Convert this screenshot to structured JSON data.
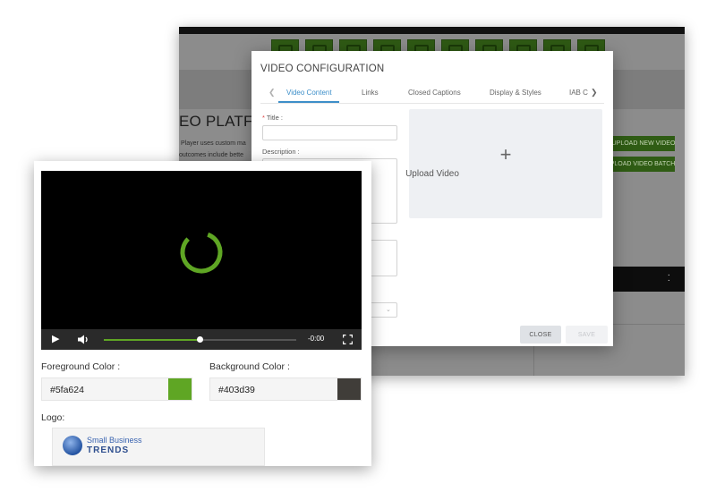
{
  "back_page": {
    "heading": "EO PLATFORM",
    "desc_line1": "Player uses custom ma",
    "desc_line2": "outcomes include bette",
    "upload_new_video": "UPLOAD NEW VIDEO",
    "upload_video_batch": "UPLOAD VIDEO BATCH",
    "toolbar_icons": [
      "home-icon",
      "upload-icon",
      "chart-icon",
      "video-icon",
      "globe-icon",
      "cube-icon",
      "stats-icon",
      "document-icon",
      "save-icon",
      "settings-icon"
    ]
  },
  "modal": {
    "title": "VIDEO CONFIGURATION",
    "tabs": [
      "Video Content",
      "Links",
      "Closed Captions",
      "Display & Styles",
      "IAB C"
    ],
    "active_tab": "Video Content",
    "title_label": "Title :",
    "title_required": "*",
    "description_label": "Description :",
    "upload_plus": "+",
    "upload_label": "Upload Video",
    "close_label": "CLOSE",
    "save_label": "SAVE"
  },
  "player": {
    "time": "-0:00",
    "progress_fraction": 0.5,
    "foreground_label": "Foreground Color :",
    "foreground_value": "#5fa624",
    "background_label": "Background Color :",
    "background_value": "#403d39",
    "logo_label": "Logo:",
    "logo_line1": "Small Business",
    "logo_line2": "TRENDS"
  },
  "colors": {
    "accent_green": "#5fa624",
    "dark_background": "#403d39",
    "active_tab_blue": "#3d8fc9"
  }
}
